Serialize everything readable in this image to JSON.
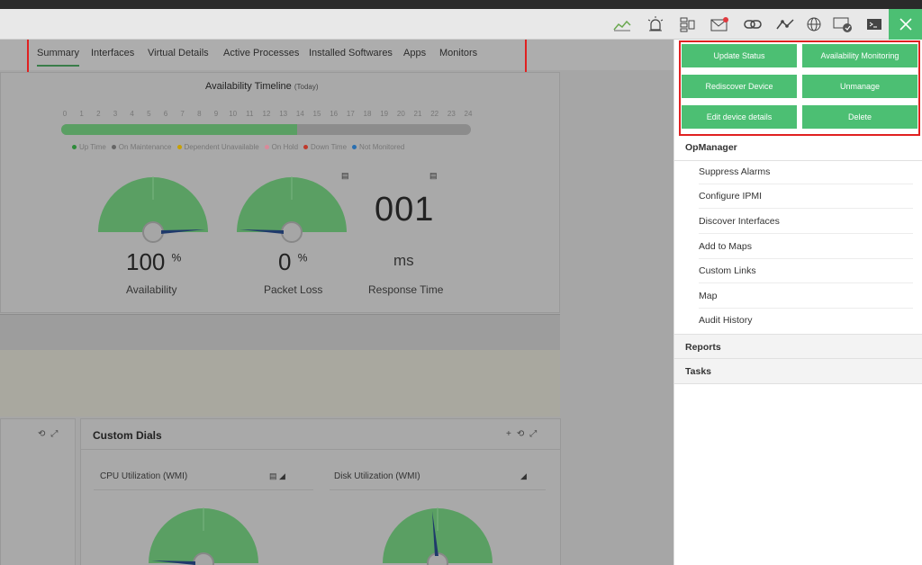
{
  "tabs": [
    "Summary",
    "Interfaces",
    "Virtual Details",
    "Active Processes",
    "Installed Softwares",
    "Apps",
    "Monitors"
  ],
  "timeline": {
    "title": "Availability Timeline",
    "period": "(Today)",
    "hours": [
      "0",
      "1",
      "2",
      "3",
      "4",
      "5",
      "6",
      "7",
      "8",
      "9",
      "10",
      "11",
      "12",
      "13",
      "14",
      "15",
      "16",
      "17",
      "18",
      "19",
      "20",
      "21",
      "22",
      "23",
      "24"
    ],
    "up_fraction": 0.575,
    "legend": [
      "Up Time",
      "On Maintenance",
      "Dependent Unavailable",
      "On Hold",
      "Down Time",
      "Not Monitored"
    ],
    "legend_colors": [
      "#2e8b3a",
      "#666666",
      "#c8a000",
      "#d98a9a",
      "#c0392b",
      "#2a6fb0"
    ]
  },
  "gauges": {
    "availability": {
      "value": "100",
      "unit": "%",
      "label": "Availability",
      "fraction": 1.0
    },
    "packet_loss": {
      "value": "0",
      "unit": "%",
      "label": "Packet Loss",
      "fraction": 0.0
    },
    "response": {
      "value": "001",
      "unit": "ms",
      "label": "Response Time"
    }
  },
  "custom_dials": {
    "title": "Custom Dials",
    "cpu": {
      "title": "CPU Utilization (WMI)",
      "fraction": 0.0
    },
    "disk": {
      "title": "Disk Utilization (WMI)",
      "fraction": 0.45
    }
  },
  "panel": {
    "buttons": [
      "Update Status",
      "Availability Monitoring",
      "Rediscover Device",
      "Unmanage",
      "Edit device details",
      "Delete"
    ],
    "opmanager_title": "OpManager",
    "opmanager_items": [
      "Suppress Alarms",
      "Configure IPMI",
      "Discover Interfaces",
      "Add to Maps",
      "Custom Links",
      "Map",
      "Audit History"
    ],
    "reports": "Reports",
    "tasks": "Tasks"
  },
  "colors": {
    "accent": "#4cbf73",
    "highlight": "#e02020",
    "gauge_green": "#5a9f63",
    "needle": "#1f3a6b"
  },
  "toolbar_icons": [
    "chart-icon",
    "alarm-icon",
    "devices-icon",
    "mail-icon",
    "link-icon",
    "graph-icon",
    "globe-icon",
    "screen-check-icon",
    "terminal-icon",
    "close-icon"
  ]
}
